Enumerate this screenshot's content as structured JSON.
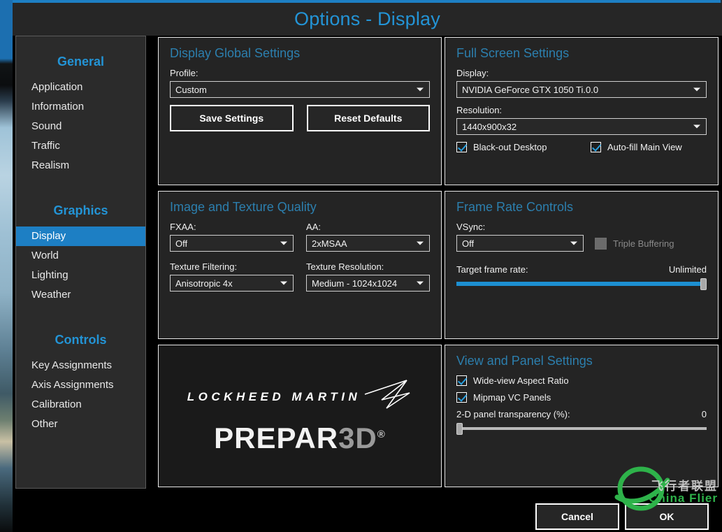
{
  "window": {
    "title": "Options - Display",
    "accent_color": "#1d7fc4",
    "heading_color": "#2394d6"
  },
  "sidebar": {
    "groups": [
      {
        "title": "General",
        "items": [
          {
            "label": "Application",
            "active": false
          },
          {
            "label": "Information",
            "active": false
          },
          {
            "label": "Sound",
            "active": false
          },
          {
            "label": "Traffic",
            "active": false
          },
          {
            "label": "Realism",
            "active": false
          }
        ]
      },
      {
        "title": "Graphics",
        "items": [
          {
            "label": "Display",
            "active": true
          },
          {
            "label": "World",
            "active": false
          },
          {
            "label": "Lighting",
            "active": false
          },
          {
            "label": "Weather",
            "active": false
          }
        ]
      },
      {
        "title": "Controls",
        "items": [
          {
            "label": "Key Assignments",
            "active": false
          },
          {
            "label": "Axis Assignments",
            "active": false
          },
          {
            "label": "Calibration",
            "active": false
          },
          {
            "label": "Other",
            "active": false
          }
        ]
      }
    ]
  },
  "panels": {
    "display_global": {
      "title": "Display Global Settings",
      "profile_label": "Profile:",
      "profile_value": "Custom",
      "save_label": "Save Settings",
      "reset_label": "Reset Defaults"
    },
    "full_screen": {
      "title": "Full Screen Settings",
      "display_label": "Display:",
      "display_value": "NVIDIA GeForce GTX 1050 Ti.0.0",
      "resolution_label": "Resolution:",
      "resolution_value": "1440x900x32",
      "blackout_label": "Black-out Desktop",
      "blackout_checked": true,
      "autofill_label": "Auto-fill Main View",
      "autofill_checked": true
    },
    "image_texture": {
      "title": "Image and Texture Quality",
      "fxaa_label": "FXAA:",
      "fxaa_value": "Off",
      "aa_label": "AA:",
      "aa_value": "2xMSAA",
      "filtering_label": "Texture Filtering:",
      "filtering_value": "Anisotropic 4x",
      "texres_label": "Texture Resolution:",
      "texres_value": "Medium - 1024x1024"
    },
    "frame_rate": {
      "title": "Frame Rate Controls",
      "vsync_label": "VSync:",
      "vsync_value": "Off",
      "triple_buffering_label": "Triple Buffering",
      "triple_buffering_checked": false,
      "triple_buffering_disabled": true,
      "target_label": "Target frame rate:",
      "target_value": "Unlimited",
      "target_percent": 100
    },
    "view_panel": {
      "title": "View and Panel Settings",
      "wideview_label": "Wide-view Aspect Ratio",
      "wideview_checked": true,
      "mipmap_label": "Mipmap VC Panels",
      "mipmap_checked": true,
      "transparency_label": "2-D panel transparency (%):",
      "transparency_value": "0",
      "transparency_percent": 0
    },
    "branding": {
      "company": "LOCKHEED MARTIN",
      "product_light": "PREPAR",
      "product_dim": "3D",
      "registered": "®"
    }
  },
  "footer": {
    "cancel_label": "Cancel",
    "ok_label": "OK"
  },
  "watermark": {
    "cn_text": "飞行者联盟",
    "en_text": "China Flier",
    "color": "#2eb24a"
  }
}
